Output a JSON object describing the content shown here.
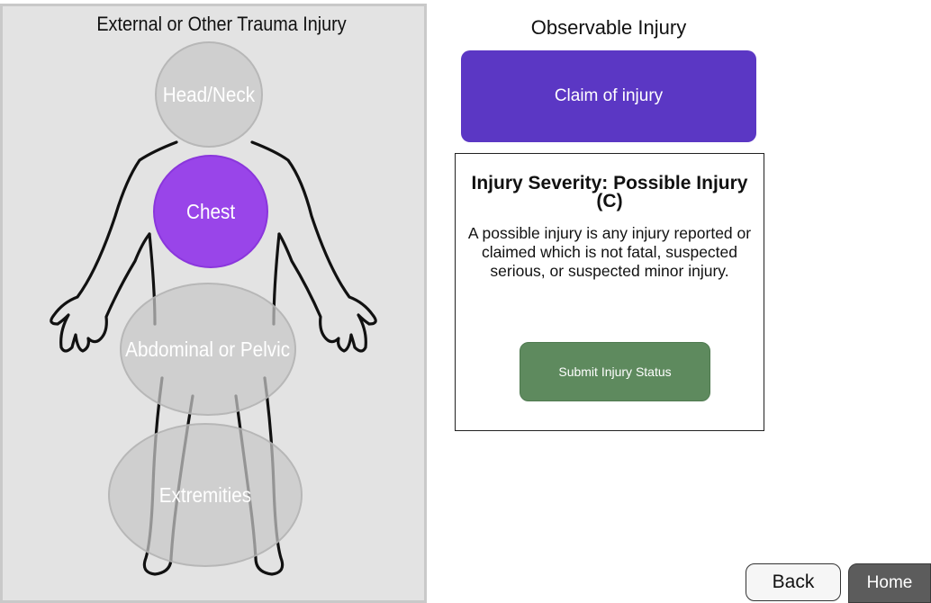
{
  "left_panel": {
    "title": "External or Other Trauma Injury",
    "regions": {
      "head_neck": "Head/Neck",
      "chest": "Chest",
      "abdominal_pelvic": "Abdominal or Pelvic",
      "extremities": "Extremities"
    },
    "selected_region": "chest"
  },
  "right_panel": {
    "title": "Observable Injury",
    "claim_button": "Claim of injury",
    "severity": {
      "title": "Injury Severity: Possible Injury (C)",
      "description": "A possible injury is any injury reported or claimed which is not fatal, suspected serious, or suspected minor injury."
    },
    "submit_button": "Submit Injury Status"
  },
  "nav": {
    "back": "Back",
    "home": "Home"
  },
  "colors": {
    "claim_button": "#5b37c4",
    "selected_region": "#9945e9",
    "submit_button": "#5e8a5e",
    "home_button": "#5c5c5c"
  }
}
